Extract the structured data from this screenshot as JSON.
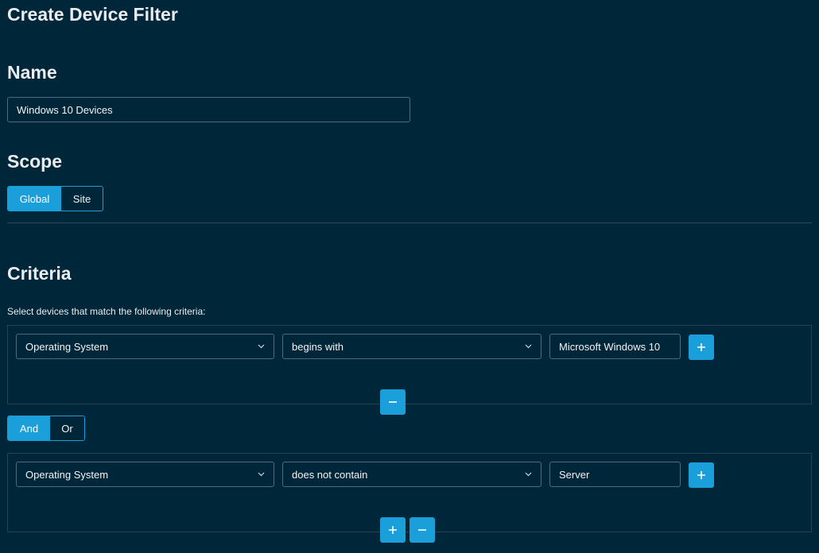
{
  "page": {
    "title": "Create Device Filter"
  },
  "name_section": {
    "heading": "Name",
    "value": "Windows 10 Devices"
  },
  "scope_section": {
    "heading": "Scope",
    "options": [
      {
        "label": "Global",
        "active": true
      },
      {
        "label": "Site",
        "active": false
      }
    ]
  },
  "criteria_section": {
    "heading": "Criteria",
    "description": "Select devices that match the following criteria:",
    "groups": [
      {
        "field": "Operating System",
        "operator": "begins with",
        "value": "Microsoft Windows 10"
      },
      {
        "field": "Operating System",
        "operator": "does not contain",
        "value": "Server"
      }
    ],
    "logic": {
      "options": [
        {
          "label": "And",
          "active": true
        },
        {
          "label": "Or",
          "active": false
        }
      ]
    }
  },
  "icons": {
    "add": "plus-icon",
    "remove": "minus-icon",
    "dropdown": "chevron-down-icon"
  },
  "colors": {
    "background": "#00263a",
    "accent": "#1a9fdb",
    "border": "#4d6c7c",
    "group_border": "#244456"
  }
}
